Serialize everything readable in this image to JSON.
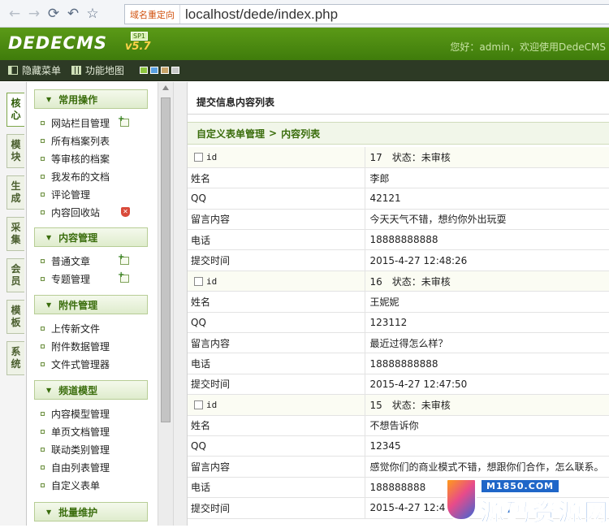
{
  "browser": {
    "redirect_label": "域名重定向",
    "url": "localhost/dede/index.php"
  },
  "header": {
    "logo": "DEDECMS",
    "version": "v5.7",
    "version_tag": "SP1",
    "welcome": "您好：admin，欢迎使用DedeCMS"
  },
  "toolbar": {
    "hide_menu": "隐藏菜单",
    "site_map": "功能地图",
    "skin_colors": [
      "#8dc63f",
      "#5aa0e0",
      "#c9a46a",
      "#c8c8c8"
    ]
  },
  "vtabs": [
    {
      "label": "核心",
      "active": true
    },
    {
      "label": "模块"
    },
    {
      "label": "生成"
    },
    {
      "label": "采集"
    },
    {
      "label": "会员"
    },
    {
      "label": "模板"
    },
    {
      "label": "系统"
    }
  ],
  "menu": {
    "sections": [
      {
        "title": "常用操作",
        "items": [
          "网站栏目管理",
          "所有档案列表",
          "等审核的档案",
          "我发布的文档",
          "评论管理",
          "内容回收站"
        ]
      },
      {
        "title": "内容管理",
        "items": [
          "普通文章",
          "专题管理"
        ]
      },
      {
        "title": "附件管理",
        "items": [
          "上传新文件",
          "附件数据管理",
          "文件式管理器"
        ]
      },
      {
        "title": "频道模型",
        "items": [
          "内容模型管理",
          "单页文档管理",
          "联动类别管理",
          "自由列表管理",
          "自定义表单"
        ]
      },
      {
        "title": "批量维护",
        "items": []
      }
    ]
  },
  "main": {
    "title": "提交信息内容列表",
    "crumb_parent": "自定义表单管理",
    "crumb_sep": ">",
    "crumb_current": "内容列表",
    "records": [
      {
        "id_label": "id",
        "id": "17",
        "status_label": "状态：",
        "status": "未审核",
        "fields": [
          {
            "label": "姓名",
            "value": "李郎"
          },
          {
            "label": "QQ",
            "value": "42121"
          },
          {
            "label": "留言内容",
            "value": "今天天气不错，想约你外出玩耍"
          },
          {
            "label": "电话",
            "value": "18888888888"
          },
          {
            "label": "提交时间",
            "value": "2015-4-27 12:48:26"
          }
        ]
      },
      {
        "id_label": "id",
        "id": "16",
        "status_label": "状态：",
        "status": "未审核",
        "fields": [
          {
            "label": "姓名",
            "value": "王妮妮"
          },
          {
            "label": "QQ",
            "value": "123112"
          },
          {
            "label": "留言内容",
            "value": "最近过得怎么样？"
          },
          {
            "label": "电话",
            "value": "18888888888"
          },
          {
            "label": "提交时间",
            "value": "2015-4-27 12:47:50"
          }
        ]
      },
      {
        "id_label": "id",
        "id": "15",
        "status_label": "状态：",
        "status": "未审核",
        "fields": [
          {
            "label": "姓名",
            "value": "不想告诉你"
          },
          {
            "label": "QQ",
            "value": "12345"
          },
          {
            "label": "留言内容",
            "value": "感觉你们的商业模式不错，想跟你们合作，怎么联系。"
          },
          {
            "label": "电话",
            "value": "188888888"
          },
          {
            "label": "提交时间",
            "value": "2015-4-27 12:47:4"
          }
        ]
      }
    ]
  },
  "watermark": {
    "url": "M1850.COM",
    "text": "源码资源网"
  }
}
